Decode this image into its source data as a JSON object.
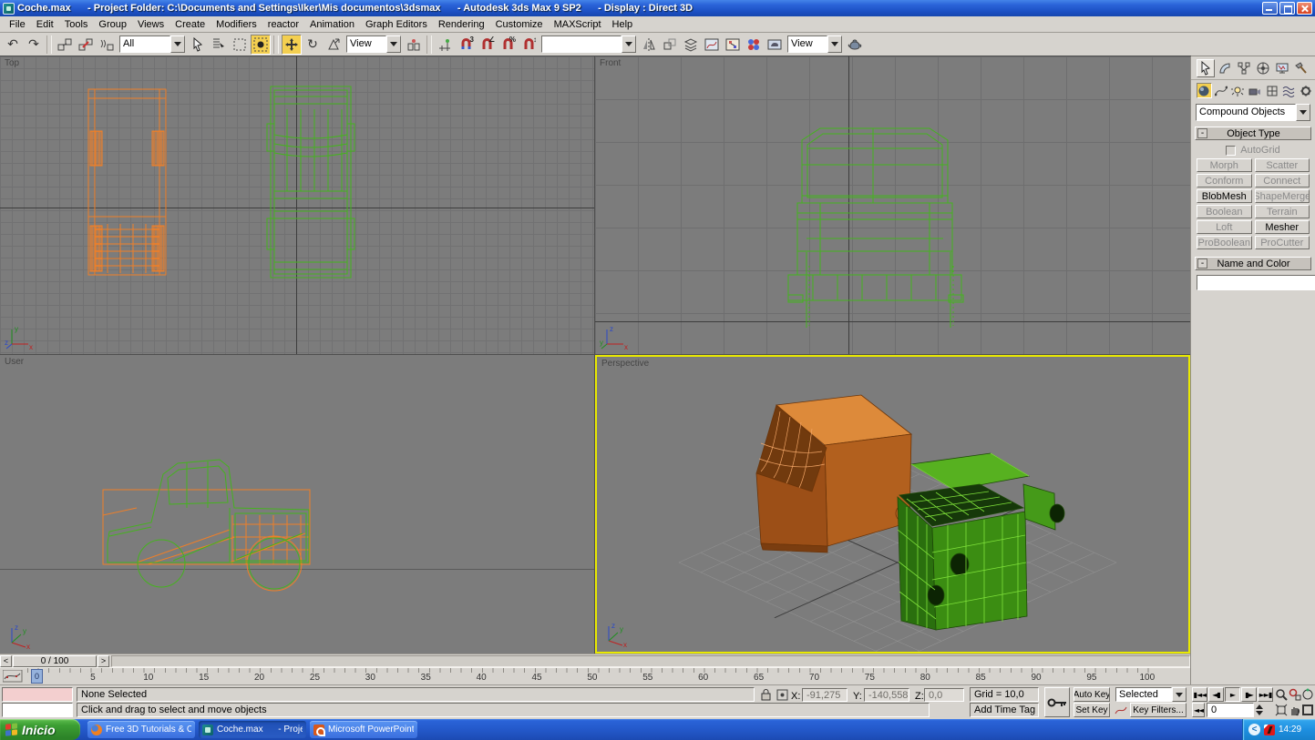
{
  "colors": {
    "accent_yellow": "#f3cf50",
    "viewport_bg": "#7c7c7c",
    "wire_orange": "#ef7f28",
    "wire_green": "#45b31e",
    "active_viewport_border": "#e9e900",
    "name_color_swatch": "#a00c4a"
  },
  "titlebar": {
    "title": "Coche.max      - Project Folder: C:\\Documents and Settings\\Iker\\Mis documentos\\3dsmax      - Autodesk 3ds Max 9 SP2      - Display : Direct 3D"
  },
  "menu": {
    "items": [
      "File",
      "Edit",
      "Tools",
      "Group",
      "Views",
      "Create",
      "Modifiers",
      "reactor",
      "Animation",
      "Graph Editors",
      "Rendering",
      "Customize",
      "MAXScript",
      "Help"
    ]
  },
  "toolbar": {
    "selection_filter_value": "All",
    "coord_system_value": "View",
    "named_selection_value": "",
    "viewport_render_value": "View"
  },
  "viewports": {
    "top_label": "Top",
    "front_label": "Front",
    "user_label": "User",
    "perspective_label": "Perspective"
  },
  "command_panel": {
    "category_dropdown_value": "Compound Objects",
    "object_type": {
      "title": "Object Type",
      "autogrid_label": "AutoGrid",
      "buttons": [
        {
          "label": "Morph",
          "enabled": false
        },
        {
          "label": "Scatter",
          "enabled": false
        },
        {
          "label": "Conform",
          "enabled": false
        },
        {
          "label": "Connect",
          "enabled": false
        },
        {
          "label": "BlobMesh",
          "enabled": true
        },
        {
          "label": "ShapeMerge",
          "enabled": false
        },
        {
          "label": "Boolean",
          "enabled": false
        },
        {
          "label": "Terrain",
          "enabled": false
        },
        {
          "label": "Loft",
          "enabled": false
        },
        {
          "label": "Mesher",
          "enabled": true
        },
        {
          "label": "ProBoolean",
          "enabled": false
        },
        {
          "label": "ProCutter",
          "enabled": false
        }
      ]
    },
    "name_and_color": {
      "title": "Name and Color",
      "name_value": ""
    }
  },
  "timeline": {
    "slider_value": "0 / 100",
    "current_frame": "0",
    "tick_labels": [
      "0",
      "5",
      "10",
      "15",
      "20",
      "25",
      "30",
      "35",
      "40",
      "45",
      "50",
      "55",
      "60",
      "65",
      "70",
      "75",
      "80",
      "85",
      "90",
      "95",
      "100"
    ]
  },
  "status": {
    "selection_text": "None Selected",
    "prompt_text": "Click and drag to select and move objects",
    "x_label": "X:",
    "x_value": "-91,275",
    "y_label": "Y:",
    "y_value": "-140,558",
    "z_label": "Z:",
    "z_value": "0,0",
    "grid_text": "Grid = 10,0",
    "time_tag_text": "Add Time Tag",
    "auto_key_label": "Auto Key",
    "set_key_label": "Set Key",
    "key_mode_value": "Selected",
    "key_filters_label": "Key Filters...",
    "frame_field_value": "0"
  },
  "icons": {
    "undo": "↶",
    "redo": "↷",
    "rotate": "↻",
    "play": "►",
    "prev_frame": "◄▮",
    "next_frame": "▮►",
    "go_start": "▮◄◄",
    "go_end": "►►▮",
    "go_start_small": "◄◄",
    "left_arrow": "<",
    "right_arrow": ">",
    "minus": "-"
  },
  "axis": {
    "x": "x",
    "y": "y",
    "z": "z"
  },
  "taskbar": {
    "start_label": "Inicio",
    "tasks": [
      {
        "label": "Free 3D Tutorials & C...",
        "icon": "firefox",
        "active": false
      },
      {
        "label": "Coche.max      - Proje...",
        "icon": "3dsmax",
        "active": true
      },
      {
        "label": "Microsoft PowerPoint ...",
        "icon": "powerpoint",
        "active": false
      }
    ],
    "clock": "14:29"
  }
}
